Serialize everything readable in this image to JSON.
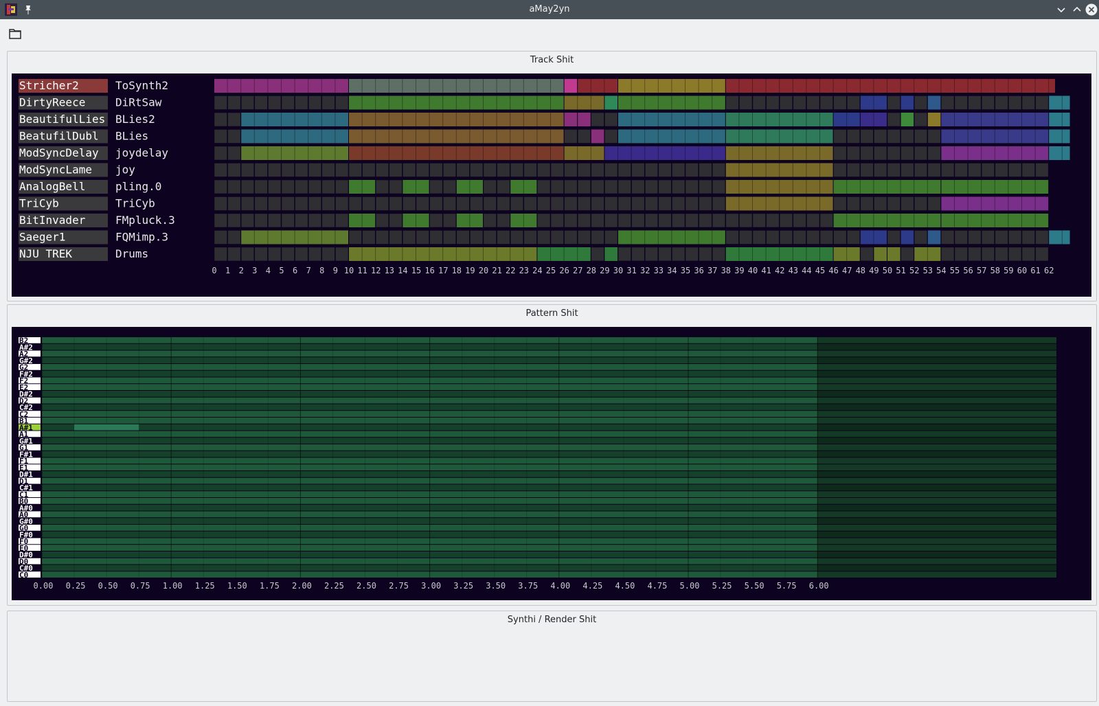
{
  "window": {
    "title": "aMay2yn",
    "app_icon": "amay2yn-app-icon",
    "buttons": [
      "pin-icon",
      "minimize-icon",
      "maximize-icon",
      "close-icon"
    ]
  },
  "toolbar": {
    "open_icon": "folder-open-icon"
  },
  "track_section": {
    "title": "Track Shit",
    "colors": {
      "background": "#0d0320",
      "empty_block": "#2e2e33",
      "selected_track": "#8b3a3a"
    },
    "tracks": [
      {
        "name": "Stricher2",
        "synth": "ToSynth2",
        "selected": true,
        "blocks": [
          {
            "start": 0,
            "len": 10,
            "color": "#8a2f7a"
          },
          {
            "start": 10,
            "len": 16,
            "color": "#5e7066"
          },
          {
            "start": 26,
            "len": 1,
            "color": "#c03a90"
          },
          {
            "start": 27,
            "len": 3,
            "color": "#8a2a30"
          },
          {
            "start": 30,
            "len": 8,
            "color": "#8a7a2a"
          },
          {
            "start": 38,
            "len": 24.5,
            "color": "#8a2a30"
          }
        ]
      },
      {
        "name": "DirtyReece",
        "synth": "DiRtSaw",
        "blocks": [
          {
            "start": 10,
            "len": 16,
            "color": "#3f7a2f"
          },
          {
            "start": 26,
            "len": 3,
            "color": "#7a6a2a"
          },
          {
            "start": 29,
            "len": 1,
            "color": "#2f8a5a"
          },
          {
            "start": 30,
            "len": 8,
            "color": "#3f7a2f"
          },
          {
            "start": 48,
            "len": 2,
            "color": "#2d3a8a"
          },
          {
            "start": 51,
            "len": 1,
            "color": "#2d3a8a"
          },
          {
            "start": 53,
            "len": 1,
            "color": "#2d5a8a"
          },
          {
            "start": 62,
            "len": 1.6,
            "color": "#2d7a8a"
          }
        ]
      },
      {
        "name": "BeautifulLies",
        "synth": "BLies2",
        "blocks": [
          {
            "start": 2,
            "len": 8,
            "color": "#2d6a80"
          },
          {
            "start": 10,
            "len": 16,
            "color": "#7a5a2f"
          },
          {
            "start": 26,
            "len": 1,
            "color": "#8a2f7a"
          },
          {
            "start": 27,
            "len": 1,
            "color": "#8a2f7a"
          },
          {
            "start": 30,
            "len": 8,
            "color": "#2d6a80"
          },
          {
            "start": 38,
            "len": 8,
            "color": "#2f7a5a"
          },
          {
            "start": 46,
            "len": 2,
            "color": "#2d3a8a"
          },
          {
            "start": 48,
            "len": 2,
            "color": "#3a2d8a"
          },
          {
            "start": 51,
            "len": 1,
            "color": "#3f8a3a"
          },
          {
            "start": 53,
            "len": 1,
            "color": "#8a7a2a"
          },
          {
            "start": 54,
            "len": 8,
            "color": "#3a3a8a"
          },
          {
            "start": 62,
            "len": 1.6,
            "color": "#2d7a8a"
          }
        ]
      },
      {
        "name": "BeatufilDubl",
        "synth": "BLies",
        "blocks": [
          {
            "start": 2,
            "len": 8,
            "color": "#2d6a80"
          },
          {
            "start": 10,
            "len": 16,
            "color": "#7a5a2f"
          },
          {
            "start": 28,
            "len": 1,
            "color": "#8a2f7a"
          },
          {
            "start": 30,
            "len": 8,
            "color": "#2d6a80"
          },
          {
            "start": 38,
            "len": 8,
            "color": "#2f7a5a"
          },
          {
            "start": 54,
            "len": 8,
            "color": "#3a3a8a"
          },
          {
            "start": 62,
            "len": 1.6,
            "color": "#2d7a8a"
          }
        ]
      },
      {
        "name": "ModSyncDelay",
        "synth": "joydelay",
        "blocks": [
          {
            "start": 2,
            "len": 8,
            "color": "#5e7a2f"
          },
          {
            "start": 10,
            "len": 16,
            "color": "#7a3a2a"
          },
          {
            "start": 26,
            "len": 3,
            "color": "#7a6a2a"
          },
          {
            "start": 29,
            "len": 9,
            "color": "#3a2a8a"
          },
          {
            "start": 38,
            "len": 8,
            "color": "#7a6a2a"
          },
          {
            "start": 54,
            "len": 8,
            "color": "#7a2f8a"
          },
          {
            "start": 62,
            "len": 1.6,
            "color": "#2d7a8a"
          }
        ]
      },
      {
        "name": "ModSyncLame",
        "synth": "joy",
        "blocks": [
          {
            "start": 38,
            "len": 8,
            "color": "#7a6a2a"
          }
        ]
      },
      {
        "name": "AnalogBell",
        "synth": "pling.0",
        "blocks": [
          {
            "start": 10,
            "len": 2,
            "color": "#3f7a2f"
          },
          {
            "start": 14,
            "len": 2,
            "color": "#3f7a2f"
          },
          {
            "start": 18,
            "len": 2,
            "color": "#3f7a2f"
          },
          {
            "start": 22,
            "len": 2,
            "color": "#3f7a2f"
          },
          {
            "start": 38,
            "len": 8,
            "color": "#7a6a2a"
          },
          {
            "start": 46,
            "len": 8,
            "color": "#3f7a2f"
          },
          {
            "start": 54,
            "len": 8,
            "color": "#3f7a2f"
          }
        ]
      },
      {
        "name": "TriCyb",
        "synth": "TriCyb",
        "blocks": [
          {
            "start": 38,
            "len": 8,
            "color": "#7a6a2a"
          },
          {
            "start": 54,
            "len": 8,
            "color": "#7a2f8a"
          }
        ]
      },
      {
        "name": "BitInvader",
        "synth": "FMpluck.3",
        "blocks": [
          {
            "start": 10,
            "len": 2,
            "color": "#3f7a2f"
          },
          {
            "start": 14,
            "len": 2,
            "color": "#3f7a2f"
          },
          {
            "start": 18,
            "len": 2,
            "color": "#3f7a2f"
          },
          {
            "start": 22,
            "len": 2,
            "color": "#3f7a2f"
          },
          {
            "start": 46,
            "len": 8,
            "color": "#3f7a2f"
          },
          {
            "start": 54,
            "len": 8,
            "color": "#3f7a2f"
          }
        ]
      },
      {
        "name": "Saeger1",
        "synth": "FQMimp.3",
        "blocks": [
          {
            "start": 2,
            "len": 8,
            "color": "#5e7a2f"
          },
          {
            "start": 30,
            "len": 8,
            "color": "#3f7a2f"
          },
          {
            "start": 48,
            "len": 2,
            "color": "#2d3a8a"
          },
          {
            "start": 51,
            "len": 1,
            "color": "#2d3a8a"
          },
          {
            "start": 53,
            "len": 1,
            "color": "#2d5a8a"
          },
          {
            "start": 62,
            "len": 1.6,
            "color": "#2d7a8a"
          }
        ]
      },
      {
        "name": "NJU TREK",
        "synth": "Drums",
        "blocks": [
          {
            "start": 10,
            "len": 14,
            "color": "#6a7a2a"
          },
          {
            "start": 24,
            "len": 4,
            "color": "#2f7a3a"
          },
          {
            "start": 29,
            "len": 1,
            "color": "#2f7a3a"
          },
          {
            "start": 38,
            "len": 8,
            "color": "#2f7a3a"
          },
          {
            "start": 46,
            "len": 2,
            "color": "#6a7a2a"
          },
          {
            "start": 49,
            "len": 1,
            "color": "#6a7a2a"
          },
          {
            "start": 50,
            "len": 1,
            "color": "#6a7a2a"
          },
          {
            "start": 52,
            "len": 2,
            "color": "#6a7a2a"
          }
        ]
      }
    ],
    "x_ticks": [
      "0",
      "1",
      "2",
      "3",
      "4",
      "5",
      "6",
      "7",
      "8",
      "9",
      "10",
      "11",
      "12",
      "13",
      "14",
      "15",
      "16",
      "17",
      "18",
      "19",
      "20",
      "21",
      "22",
      "23",
      "24",
      "25",
      "26",
      "27",
      "28",
      "29",
      "30",
      "31",
      "32",
      "33",
      "34",
      "35",
      "36",
      "37",
      "38",
      "39",
      "40",
      "41",
      "42",
      "43",
      "44",
      "45",
      "46",
      "47",
      "48",
      "49",
      "50",
      "51",
      "52",
      "53",
      "54",
      "55",
      "56",
      "57",
      "58",
      "59",
      "60",
      "61",
      "62"
    ]
  },
  "pattern_section": {
    "title": "Pattern Shit",
    "notes_top_to_bottom": [
      "B2",
      "A#2",
      "A2",
      "G#2",
      "G2",
      "F#2",
      "F2",
      "E2",
      "D#2",
      "D2",
      "C#2",
      "C2",
      "B1",
      "A#1",
      "A1",
      "G#1",
      "G1",
      "F#1",
      "F1",
      "E1",
      "D#1",
      "D1",
      "C#1",
      "C1",
      "B0",
      "A#0",
      "A0",
      "G#0",
      "G0",
      "F#0",
      "F0",
      "E0",
      "D#0",
      "D0",
      "C#0",
      "C0"
    ],
    "highlighted_note": "A#1",
    "beat_ticks": [
      "0.00",
      "0.25",
      "0.50",
      "0.75",
      "1.00",
      "1.25",
      "1.50",
      "1.75",
      "2.00",
      "2.25",
      "2.50",
      "2.75",
      "3.00",
      "3.25",
      "3.50",
      "3.75",
      "4.00",
      "4.25",
      "4.50",
      "4.75",
      "5.00",
      "5.25",
      "5.50",
      "5.75",
      "6.00"
    ],
    "pattern_length_beats": 6.0,
    "notes": [
      {
        "pitch": "A#1",
        "start": 0.25,
        "length": 0.5
      }
    ],
    "colors": {
      "white_key_row": "#1e5a3a",
      "black_key_row": "#15402a",
      "beyond_row_white": "#143a26",
      "beyond_row_black": "#0e2a1b",
      "note": "#2a7a55",
      "label_highlight": "#9bd23a"
    }
  },
  "synth_section": {
    "title": "Synthi / Render Shit"
  }
}
